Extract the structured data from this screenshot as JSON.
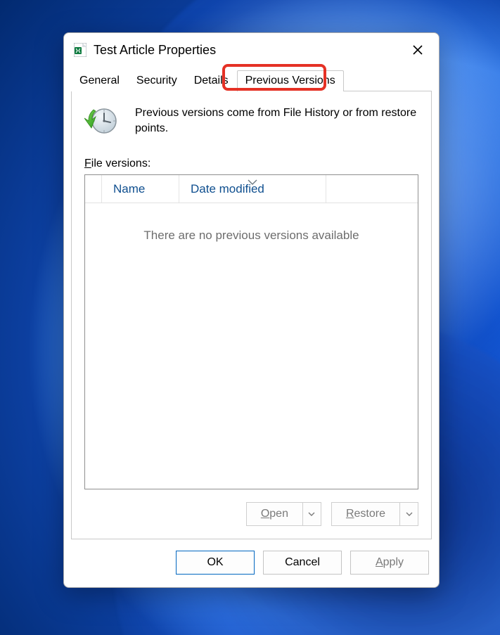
{
  "window": {
    "title": "Test Article Properties"
  },
  "tabs": {
    "general": "General",
    "security": "Security",
    "details": "Details",
    "previous_versions": "Previous Versions"
  },
  "info_text": "Previous versions come from File History or from restore points.",
  "versions_label_prefix": "F",
  "versions_label_rest": "ile versions:",
  "list": {
    "col_name": "Name",
    "col_date": "Date modified",
    "empty": "There are no previous versions available"
  },
  "actions": {
    "open_u": "O",
    "open_rest": "pen",
    "restore_u": "R",
    "restore_rest": "estore"
  },
  "footer": {
    "ok": "OK",
    "cancel": "Cancel",
    "apply_u": "A",
    "apply_rest": "pply"
  }
}
